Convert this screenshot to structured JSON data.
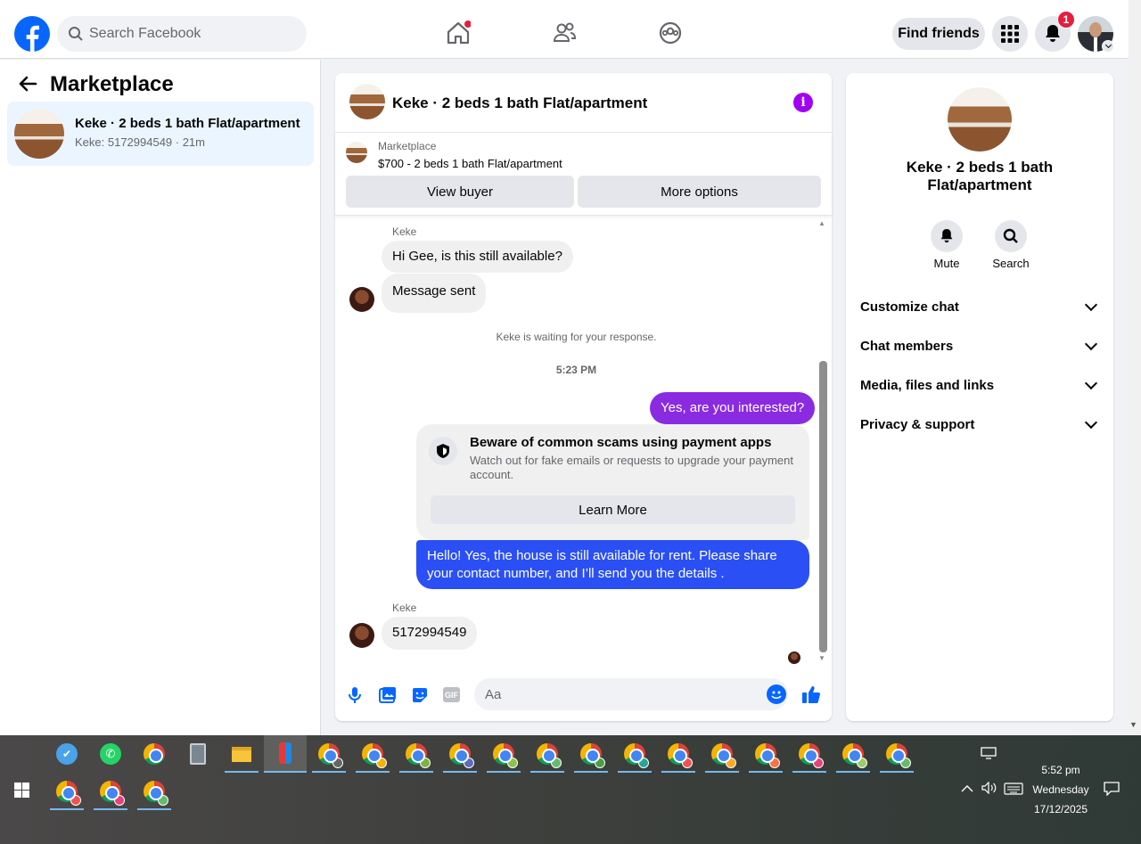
{
  "topbar": {
    "search_placeholder": "Search Facebook",
    "find_friends": "Find friends",
    "notification_count": "1"
  },
  "left": {
    "title": "Marketplace",
    "conversation": {
      "title": "Keke · 2 beds 1 bath Flat/apartment",
      "subtitle": "Keke: 5172994549 · 21m"
    }
  },
  "chat": {
    "title": "Keke · 2 beds 1 bath Flat/apartment",
    "listing_source": "Marketplace",
    "listing_text": "$700 - 2 beds 1 bath Flat/apartment",
    "view_buyer": "View buyer",
    "more_options": "More options",
    "sender_name_1": "Keke",
    "msg_1": "Hi Gee, is this still available?",
    "msg_2": "Message sent",
    "waiting": "Keke is waiting for your response.",
    "time": "5:23 PM",
    "reply_1": "Yes, are you interested?",
    "scam_title": "Beware of common scams using payment apps",
    "scam_text": "Watch out for fake emails or requests to upgrade your payment account.",
    "learn_more": "Learn More",
    "reply_2": "Hello! Yes, the house is still available for rent. Please share your contact number, and I’ll send you the details .",
    "sender_name_2": "Keke",
    "msg_3": "5172994549",
    "composer_placeholder": "Aa"
  },
  "right": {
    "title": "Keke · 2 beds 1 bath Flat/apartment",
    "mute": "Mute",
    "search": "Search",
    "sections": [
      "Customize chat",
      "Chat members",
      "Media, files and links",
      "Privacy & support"
    ]
  },
  "taskbar": {
    "time": "5:52 pm",
    "day": "Wednesday",
    "date": "17/12/2025"
  },
  "colors": {
    "brand": "#0866ff",
    "bubble_purple": "#8a2be2",
    "bubble_blue": "#2a4ff5"
  }
}
